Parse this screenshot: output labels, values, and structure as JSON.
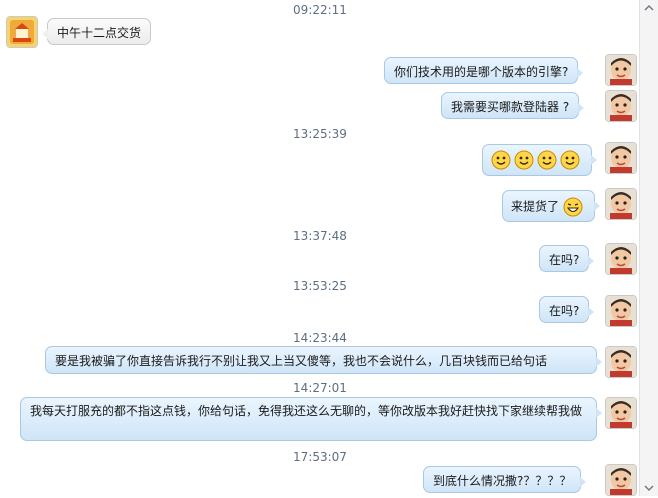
{
  "timestamps": [
    "09:22:11",
    "13:25:39",
    "13:37:48",
    "13:53:25",
    "14:23:44",
    "14:27:01",
    "17:53:07"
  ],
  "messages": [
    {
      "text": "中午十二点交货"
    },
    {
      "text": "你们技术用的是哪个版本的引擎?"
    },
    {
      "text": "我需要买哪款登陆器 ?"
    },
    {
      "text": ""
    },
    {
      "text": "来提货了"
    },
    {
      "text": "在吗?"
    },
    {
      "text": "在吗?"
    },
    {
      "text": "要是我被骗了你直接告诉我行不别让我又上当又傻等，我也不会说什么，几百块钱而已给句话"
    },
    {
      "text": "我每天打服充的都不指这点钱，你给句话，免得我还这么无聊的，等你改版本我好赶快找下家继续帮我做"
    },
    {
      "text": "到底什么情况撒?？？？？"
    }
  ],
  "icons": {
    "smiley": "smiley-emoticon",
    "grin": "grin-emoticon",
    "avatar_self": "user-avatar",
    "avatar_contact": "contact-avatar"
  },
  "colors": {
    "bubble_me": "#cfe5f7",
    "bubble_them": "#ececec",
    "timestamp": "#5d6f80"
  }
}
